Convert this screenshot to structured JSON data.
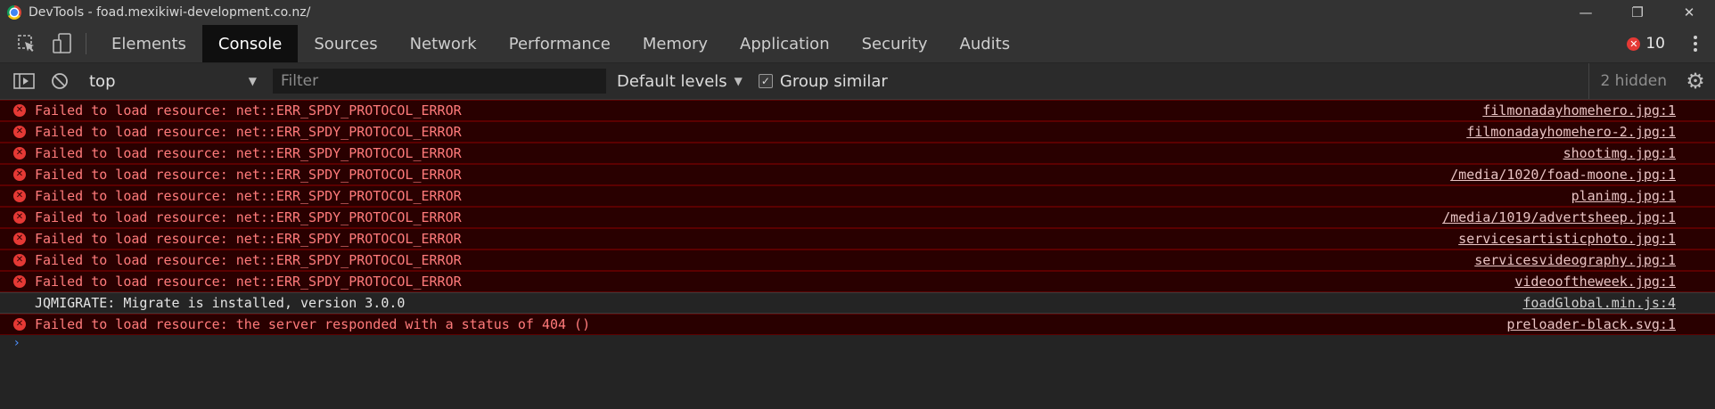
{
  "window": {
    "title": "DevTools - foad.mexikiwi-development.co.nz/",
    "minimize": "—",
    "maximize": "❐",
    "close": "✕"
  },
  "tabs": [
    {
      "label": "Elements",
      "active": false
    },
    {
      "label": "Console",
      "active": true
    },
    {
      "label": "Sources",
      "active": false
    },
    {
      "label": "Network",
      "active": false
    },
    {
      "label": "Performance",
      "active": false
    },
    {
      "label": "Memory",
      "active": false
    },
    {
      "label": "Application",
      "active": false
    },
    {
      "label": "Security",
      "active": false
    },
    {
      "label": "Audits",
      "active": false
    }
  ],
  "error_badge": {
    "count": "10",
    "color": "#e53935"
  },
  "console_toolbar": {
    "context": "top",
    "filter_placeholder": "Filter",
    "levels": "Default levels",
    "group_similar": "Group similar",
    "group_similar_checked": true,
    "hidden": "2 hidden"
  },
  "messages": [
    {
      "level": "error",
      "text": "Failed to load resource: net::ERR_SPDY_PROTOCOL_ERROR",
      "source": "filmonadayhomehero.jpg:1"
    },
    {
      "level": "error",
      "text": "Failed to load resource: net::ERR_SPDY_PROTOCOL_ERROR",
      "source": "filmonadayhomehero-2.jpg:1"
    },
    {
      "level": "error",
      "text": "Failed to load resource: net::ERR_SPDY_PROTOCOL_ERROR",
      "source": "shootimg.jpg:1"
    },
    {
      "level": "error",
      "text": "Failed to load resource: net::ERR_SPDY_PROTOCOL_ERROR",
      "source": "/media/1020/foad-moone.jpg:1"
    },
    {
      "level": "error",
      "text": "Failed to load resource: net::ERR_SPDY_PROTOCOL_ERROR",
      "source": "planimg.jpg:1"
    },
    {
      "level": "error",
      "text": "Failed to load resource: net::ERR_SPDY_PROTOCOL_ERROR",
      "source": "/media/1019/advertsheep.jpg:1"
    },
    {
      "level": "error",
      "text": "Failed to load resource: net::ERR_SPDY_PROTOCOL_ERROR",
      "source": "servicesartisticphoto.jpg:1"
    },
    {
      "level": "error",
      "text": "Failed to load resource: net::ERR_SPDY_PROTOCOL_ERROR",
      "source": "servicesvideography.jpg:1"
    },
    {
      "level": "error",
      "text": "Failed to load resource: net::ERR_SPDY_PROTOCOL_ERROR",
      "source": "videooftheweek.jpg:1"
    },
    {
      "level": "log",
      "text": "JQMIGRATE: Migrate is installed, version 3.0.0",
      "source": "foadGlobal.min.js:4"
    },
    {
      "level": "error",
      "text": "Failed to load resource: the server responded with a status of 404 ()",
      "source": "preloader-black.svg:1"
    }
  ],
  "prompt": "›",
  "colors": {
    "error_bg": "#290000",
    "error_text": "#ff7b7b",
    "panel_bg": "#333333",
    "active_tab_bg": "#0f0f0f"
  }
}
